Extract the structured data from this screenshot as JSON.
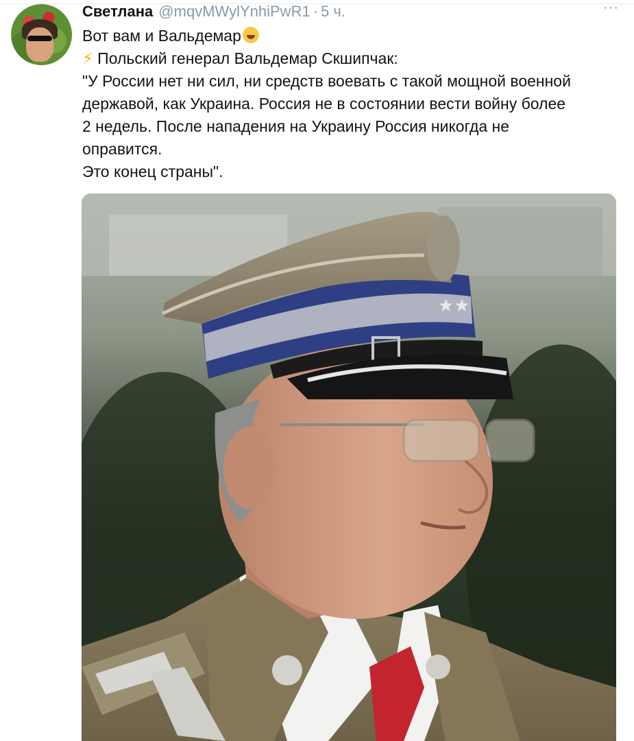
{
  "tweet": {
    "author_name": "Светлана",
    "author_handle": "@mqvMWylYnhiPwR1",
    "separator": "·",
    "time": "5 ч.",
    "more_label": "···",
    "lines": [
      "Вот вам и Вальдемар",
      "Польский генерал Вальдемар Скшипчак:",
      "\"У России нет ни сил, ни средств воевать с такой мощной военной",
      "державой, как Украина. Россия не в состоянии вести войну более",
      "2 недель. После нападения на Украину Россия никогда не",
      "оправится.",
      "Это конец страны\"."
    ],
    "icons": {
      "laugh": "rolling-on-floor-laughing-emoji",
      "bolt": "high-voltage-emoji",
      "more": "more-dots-icon"
    }
  },
  "colors": {
    "text": "#0f1419",
    "secondary": "#8899a6",
    "bolt": "#f5b400"
  }
}
